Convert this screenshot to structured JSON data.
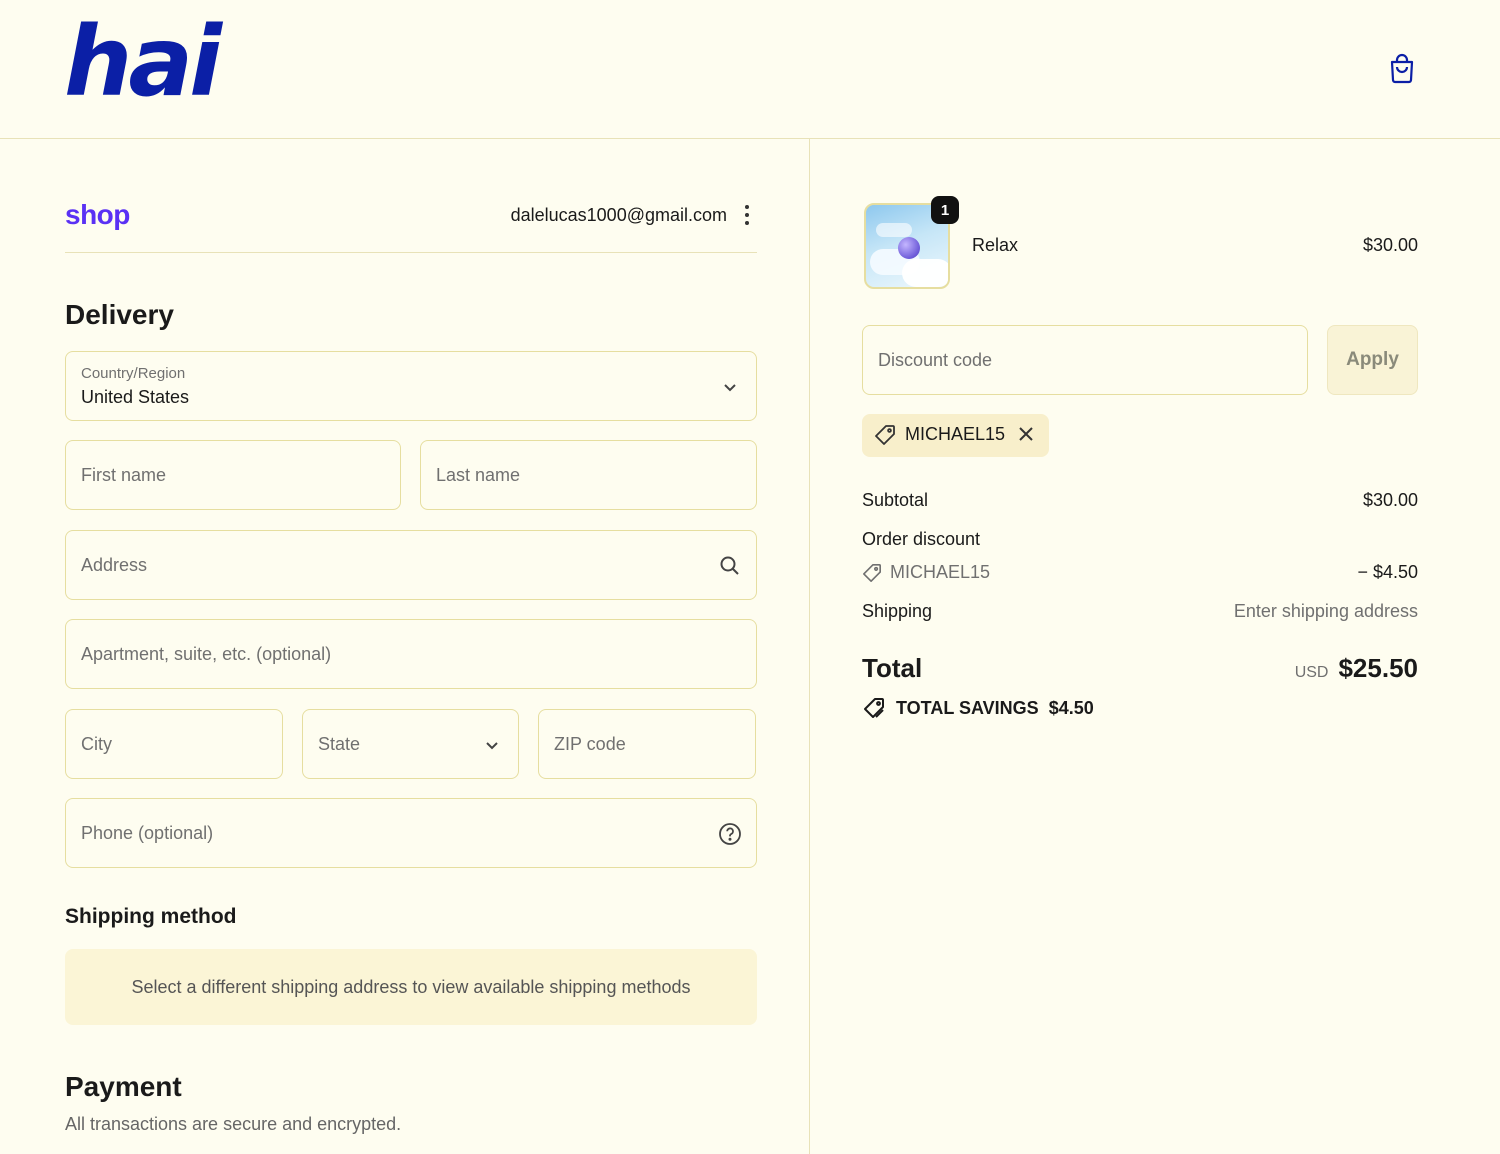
{
  "header": {
    "logo_text": "hai",
    "cart_icon": "shopping-bag-icon"
  },
  "account": {
    "shop_logo": "shop",
    "email": "dalelucas1000@gmail.com",
    "menu_icon": "kebab-menu-icon"
  },
  "delivery": {
    "heading": "Delivery",
    "country_label": "Country/Region",
    "country_value": "United States",
    "first_name_placeholder": "First name",
    "last_name_placeholder": "Last name",
    "address_placeholder": "Address",
    "apartment_placeholder": "Apartment, suite, etc. (optional)",
    "city_placeholder": "City",
    "state_placeholder": "State",
    "zip_placeholder": "ZIP code",
    "phone_placeholder": "Phone (optional)"
  },
  "shipping_method": {
    "heading": "Shipping method",
    "notice": "Select a different shipping address to view available shipping methods"
  },
  "payment": {
    "heading": "Payment",
    "subtext": "All transactions are secure and encrypted."
  },
  "order": {
    "item": {
      "name": "Relax",
      "price": "$30.00",
      "quantity": "1"
    },
    "discount_placeholder": "Discount code",
    "apply_label": "Apply",
    "applied_code": "MICHAEL15",
    "subtotal_label": "Subtotal",
    "subtotal_value": "$30.00",
    "order_discount_label": "Order discount",
    "discount_code": "MICHAEL15",
    "discount_value": "− $4.50",
    "shipping_label": "Shipping",
    "shipping_value": "Enter shipping address",
    "total_label": "Total",
    "currency": "USD",
    "total_value": "$25.50",
    "savings_label": "TOTAL SAVINGS",
    "savings_value": "$4.50"
  },
  "colors": {
    "background": "#fefdf0",
    "brand": "#0b1fa6",
    "shop_purple": "#5a31f4",
    "border": "#e6dea0"
  }
}
